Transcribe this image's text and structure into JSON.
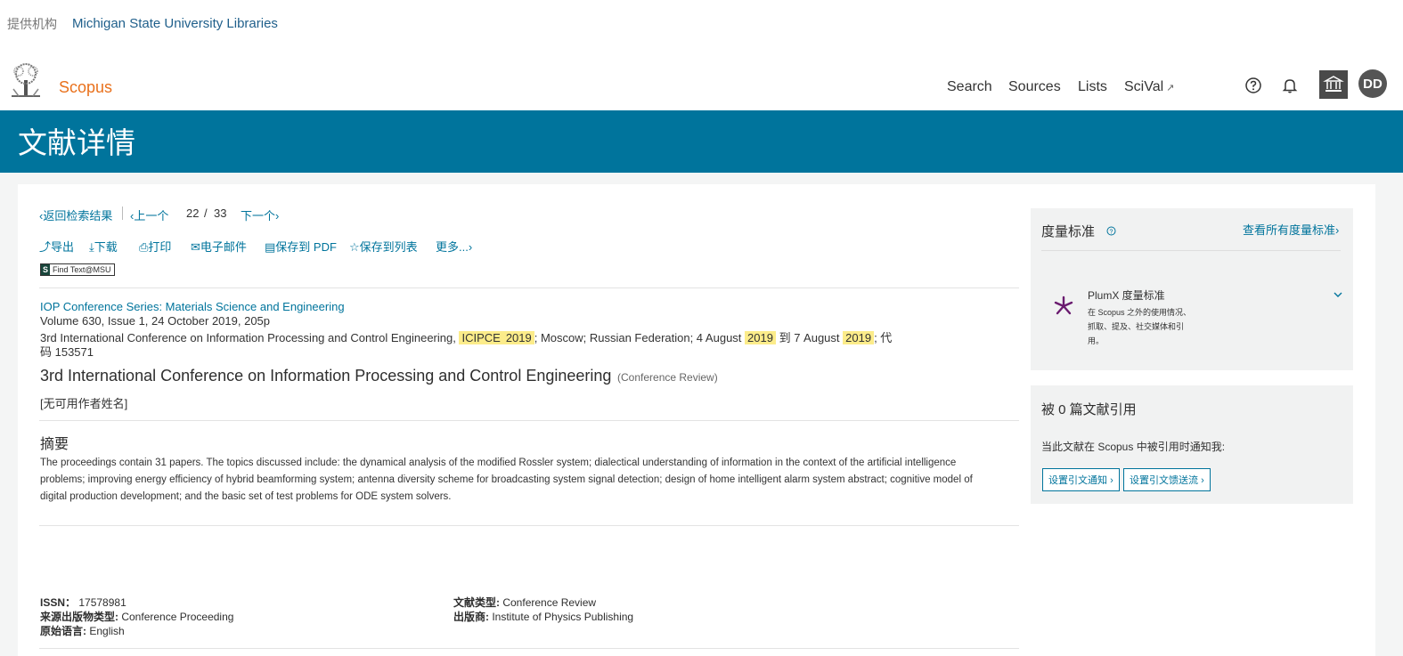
{
  "header": {
    "provider_label": "提供机构",
    "provider_name": "Michigan State University Libraries",
    "brand": "Scopus",
    "nav": [
      "Search",
      "Sources",
      "Lists",
      "SciVal"
    ],
    "scival_arrow": "↗",
    "avatar_initials": "DD"
  },
  "page_title": "文献详情",
  "nav_row": {
    "back": "返回检索结果",
    "prev": "上一个",
    "position": "22",
    "slash": "/",
    "total": "33",
    "next": "下一个"
  },
  "toolbar": {
    "export": "导出",
    "download": "下载",
    "print": "打印",
    "email": "电子邮件",
    "save_pdf": "保存到 PDF",
    "save_list": "保存到列表",
    "more": "更多..."
  },
  "findtext": {
    "s": "S",
    "label": "Find Text@MSU"
  },
  "document": {
    "source_title": "IOP Conference Series: Materials Science and Engineering",
    "volume_line": "Volume 630, Issue 1, 24 October 2019, 205p",
    "conf_line_a": "3rd International Conference on Information Processing and Control Engineering,",
    "conf_hl_1": "ICIPCE",
    "conf_hl_2": "2019",
    "conf_line_b": "; Moscow; Russian Federation; 4 August",
    "conf_hl_3": "2019",
    "conf_line_c": "到 7 August",
    "conf_hl_4": "2019",
    "conf_line_d": "; 代",
    "code_line": "码 153571",
    "title": "3rd International Conference on Information Processing and Control Engineering",
    "doc_type_tag": "(Conference Review)",
    "authors": "[无可用作者姓名]",
    "abstract_heading": "摘要",
    "abstract_lines": [
      "The proceedings contain 31 papers. The topics discussed include: the dynamical analysis of the modified Rossler system; dialectical understanding of information in the context of the artificial intelligence",
      "problems; improving energy efficiency of hybrid beamforming system; antenna diversity scheme for broadcasting system signal detection; design of home intelligent alarm system abstract; cognitive model of",
      "digital production development; and the basic set of test problems for ODE system solvers."
    ]
  },
  "meta": {
    "issn_label": "ISSN：",
    "issn_value": "17578981",
    "source_type_label": "来源出版物类型:",
    "source_type_value": "Conference Proceeding",
    "language_label": "原始语言:",
    "language_value": "English",
    "doc_type_label": "文献类型:",
    "doc_type_value": "Conference Review",
    "publisher_label": "出版商:",
    "publisher_value": "Institute of Physics Publishing"
  },
  "metrics": {
    "title": "度量标准",
    "view_all": "查看所有度量标准",
    "plumx_title": "PlumX 度量标准",
    "plumx_desc": [
      "在 Scopus 之外的使用情况、",
      "抓取、提及、社交媒体和引",
      "用。"
    ]
  },
  "citations": {
    "title": "被 0 篇文献引用",
    "notify_text": "当此文献在 Scopus 中被引用时通知我:",
    "btn_alert": "设置引文通知",
    "btn_feed": "设置引文馈送流"
  },
  "colors": {
    "primary": "#00749c",
    "brand_orange": "#e9711c",
    "highlight": "#fcec8a"
  }
}
